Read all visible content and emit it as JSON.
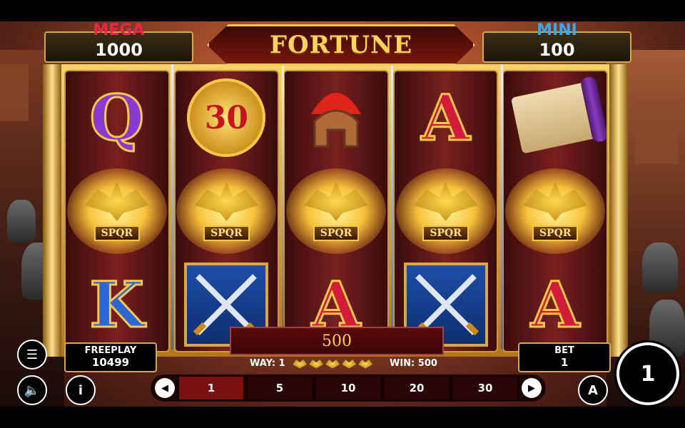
{
  "game": {
    "title": "FORTUNE",
    "jackpots": [
      {
        "label": "MEGA",
        "value": "1000",
        "color": "#e8264a"
      },
      {
        "label": "MINI",
        "value": "100",
        "color": "#3aa8f0"
      }
    ]
  },
  "reels": [
    {
      "symbols": [
        {
          "type": "letter",
          "text": "Q",
          "icon": "queen-letter-icon"
        },
        {
          "type": "eagle",
          "text": "SPQR",
          "icon": "golden-eagle-icon"
        },
        {
          "type": "letter",
          "text": "K",
          "icon": "king-letter-icon"
        }
      ]
    },
    {
      "symbols": [
        {
          "type": "coin",
          "text": "30",
          "icon": "gold-coin-icon"
        },
        {
          "type": "eagle",
          "text": "SPQR",
          "icon": "golden-eagle-icon"
        },
        {
          "type": "shield",
          "text": "",
          "icon": "crossed-swords-shield-icon"
        }
      ]
    },
    {
      "symbols": [
        {
          "type": "helmet",
          "text": "",
          "icon": "roman-helmet-icon"
        },
        {
          "type": "eagle",
          "text": "SPQR",
          "icon": "golden-eagle-icon"
        },
        {
          "type": "letter",
          "text": "A",
          "icon": "ace-letter-icon"
        }
      ]
    },
    {
      "symbols": [
        {
          "type": "letter",
          "text": "A",
          "icon": "ace-letter-icon"
        },
        {
          "type": "eagle",
          "text": "SPQR",
          "icon": "golden-eagle-icon"
        },
        {
          "type": "shield",
          "text": "",
          "icon": "crossed-swords-shield-icon"
        }
      ]
    },
    {
      "symbols": [
        {
          "type": "scroll",
          "text": "",
          "icon": "scroll-icon"
        },
        {
          "type": "eagle",
          "text": "SPQR",
          "icon": "golden-eagle-icon"
        },
        {
          "type": "letter",
          "text": "A",
          "icon": "ace-letter-icon"
        }
      ]
    }
  ],
  "win_display": "500",
  "freeplay": {
    "label": "FREEPLAY",
    "value": "10499"
  },
  "bet": {
    "label": "BET",
    "value": "1"
  },
  "way": {
    "label": "WAY: 1",
    "eagles": 5
  },
  "win": {
    "label": "WIN: 500"
  },
  "bet_options": [
    "1",
    "5",
    "10",
    "20",
    "30"
  ],
  "selected_bet": "1",
  "controls": {
    "menu": "☰",
    "sound": "🔈",
    "info": "i",
    "auto": "A",
    "prev": "◀",
    "next": "▶",
    "spin": "1"
  }
}
